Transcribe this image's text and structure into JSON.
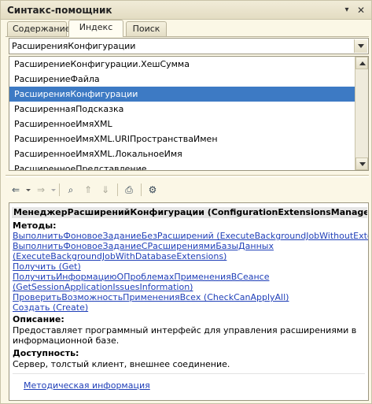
{
  "window": {
    "title": "Синтакс-помощник"
  },
  "tabs": [
    {
      "label": "Содержание"
    },
    {
      "label": "Индекс"
    },
    {
      "label": "Поиск"
    }
  ],
  "search": {
    "value": "РасширенияКонфигурации"
  },
  "index_list": {
    "items": [
      {
        "label": "РасширениеКонфигурации.ХешСумма"
      },
      {
        "label": "РасширениеФайла"
      },
      {
        "label": "РасширенияКонфигурации"
      },
      {
        "label": "РасширеннаяПодсказка"
      },
      {
        "label": "РасширенноеИмяXML"
      },
      {
        "label": "РасширенноеИмяXML.URIПространстваИмен"
      },
      {
        "label": "РасширенноеИмяXML.ЛокальноеИмя"
      },
      {
        "label": "РасширенноеПредставление"
      }
    ],
    "selected_index": 2
  },
  "toolbar": {
    "icons": [
      "back-icon",
      "forward-icon",
      "find-in-list-icon",
      "sync-up-icon",
      "sync-down-icon",
      "print-icon",
      "settings-icon"
    ]
  },
  "topic": {
    "header": "МенеджерРасширенийКонфигурации (ConfigurationExtensionsManager)",
    "methods_title": "Методы:",
    "methods": [
      "ВыполнитьФоновоеЗаданиеБезРасширений (ExecuteBackgroundJobWithoutExtensions)",
      "ВыполнитьФоновоеЗаданиеСРасширениямиБазыДанных",
      "(ExecuteBackgroundJobWithDatabaseExtensions)",
      "Получить (Get)",
      "ПолучитьИнформациюОПроблемахПримененияВСеансе",
      "(GetSessionApplicationIssuesInformation)",
      "ПроверитьВозможностьПримененияВсех (CheckCanApplyAll)",
      "Создать (Create)"
    ],
    "description_title": "Описание:",
    "description_lines": [
      "Предоставляет программный интерфейс для управления расширениями в",
      "информационной базе."
    ],
    "availability_title": "Доступность:",
    "availability_text": "Сервер, толстый клиент, внешнее соединение.",
    "methodical_link": "Методическая информация"
  },
  "colors": {
    "selection": "#3d7ac4",
    "link": "#1f3fb8",
    "panel": "#fbf7e6"
  }
}
